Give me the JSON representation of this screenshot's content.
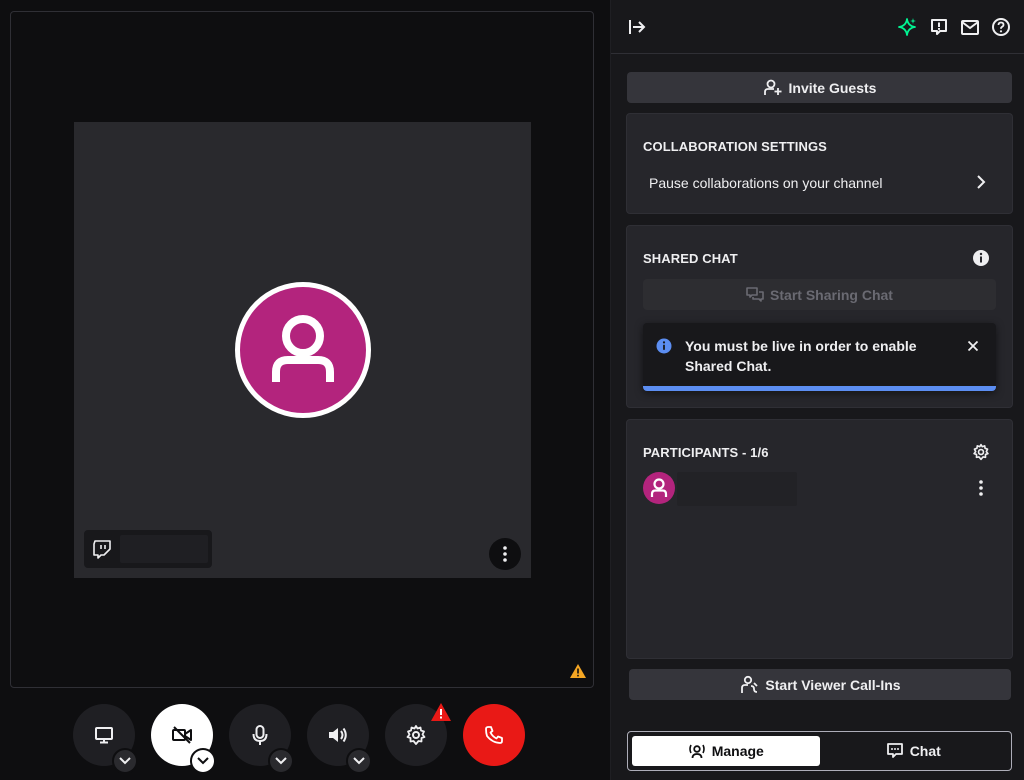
{
  "stage": {
    "name_tag_icon": "twitch-glitch-icon",
    "more_icon": "kebab-vertical-icon",
    "warning_icon": "warning-triangle-icon"
  },
  "controls": [
    {
      "name": "screen-share-button",
      "icon": "monitor-icon"
    },
    {
      "name": "camera-off-button",
      "icon": "camera-off-icon"
    },
    {
      "name": "microphone-button",
      "icon": "microphone-icon"
    },
    {
      "name": "speaker-button",
      "icon": "speaker-icon"
    },
    {
      "name": "settings-button",
      "icon": "gear-icon"
    },
    {
      "name": "leave-call-button",
      "icon": "phone-hangup-icon"
    }
  ],
  "colors": {
    "accent_purple": "#b3247d",
    "danger_red": "#e91916",
    "info_blue": "#5c8ef2",
    "sparkle_green": "#00f593",
    "warning_yellow": "#f5a623"
  },
  "panel": {
    "invite_label": "Invite Guests",
    "collab": {
      "title": "COLLABORATION SETTINGS",
      "row_label": "Pause collaborations on your channel"
    },
    "shared_chat": {
      "title": "SHARED CHAT",
      "button_label": "Start Sharing Chat",
      "toast_message": "You must be live in order to enable Shared Chat.",
      "toast_progress": 1.0
    },
    "participants": {
      "title": "PARTICIPANTS - 1/6"
    },
    "call_in_label": "Start Viewer Call-Ins",
    "tabs": [
      {
        "label": "Manage",
        "active": true
      },
      {
        "label": "Chat",
        "active": false
      }
    ]
  }
}
